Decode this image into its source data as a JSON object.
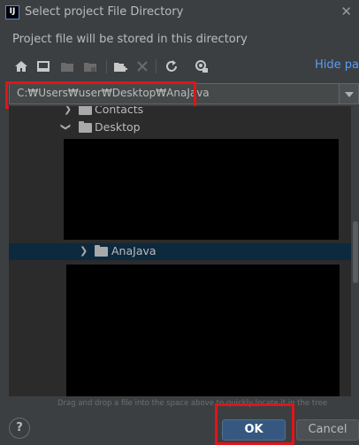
{
  "window": {
    "app_icon_text": "IJ",
    "title": "Select project File Directory",
    "subtitle": "Project file will be stored in this directory"
  },
  "toolbar": {
    "icons": [
      "home-icon",
      "desktop-icon",
      "project-folder-icon",
      "module-folder-icon",
      "new-folder-icon",
      "delete-icon",
      "refresh-icon",
      "show-hidden-icon"
    ],
    "hide_path_label": "Hide path"
  },
  "path": {
    "value": "C:₩Users₩user₩Desktop₩AnaJava"
  },
  "tree": {
    "rows": [
      {
        "label": "Contacts",
        "expanded": false
      },
      {
        "label": "Desktop",
        "expanded": true
      },
      {
        "label": "AnaJava",
        "expanded": false,
        "selected": true
      }
    ]
  },
  "hint": "Drag and drop a file into the space above to quickly locate it in the tree",
  "buttons": {
    "help": "?",
    "ok": "OK",
    "cancel": "Cancel"
  },
  "colors": {
    "background": "#3c3f41",
    "tree_background": "#2b2b2b",
    "selection": "#0d293e",
    "link": "#589df6",
    "ok_button": "#365880",
    "highlight_annotation": "#e0141a"
  }
}
